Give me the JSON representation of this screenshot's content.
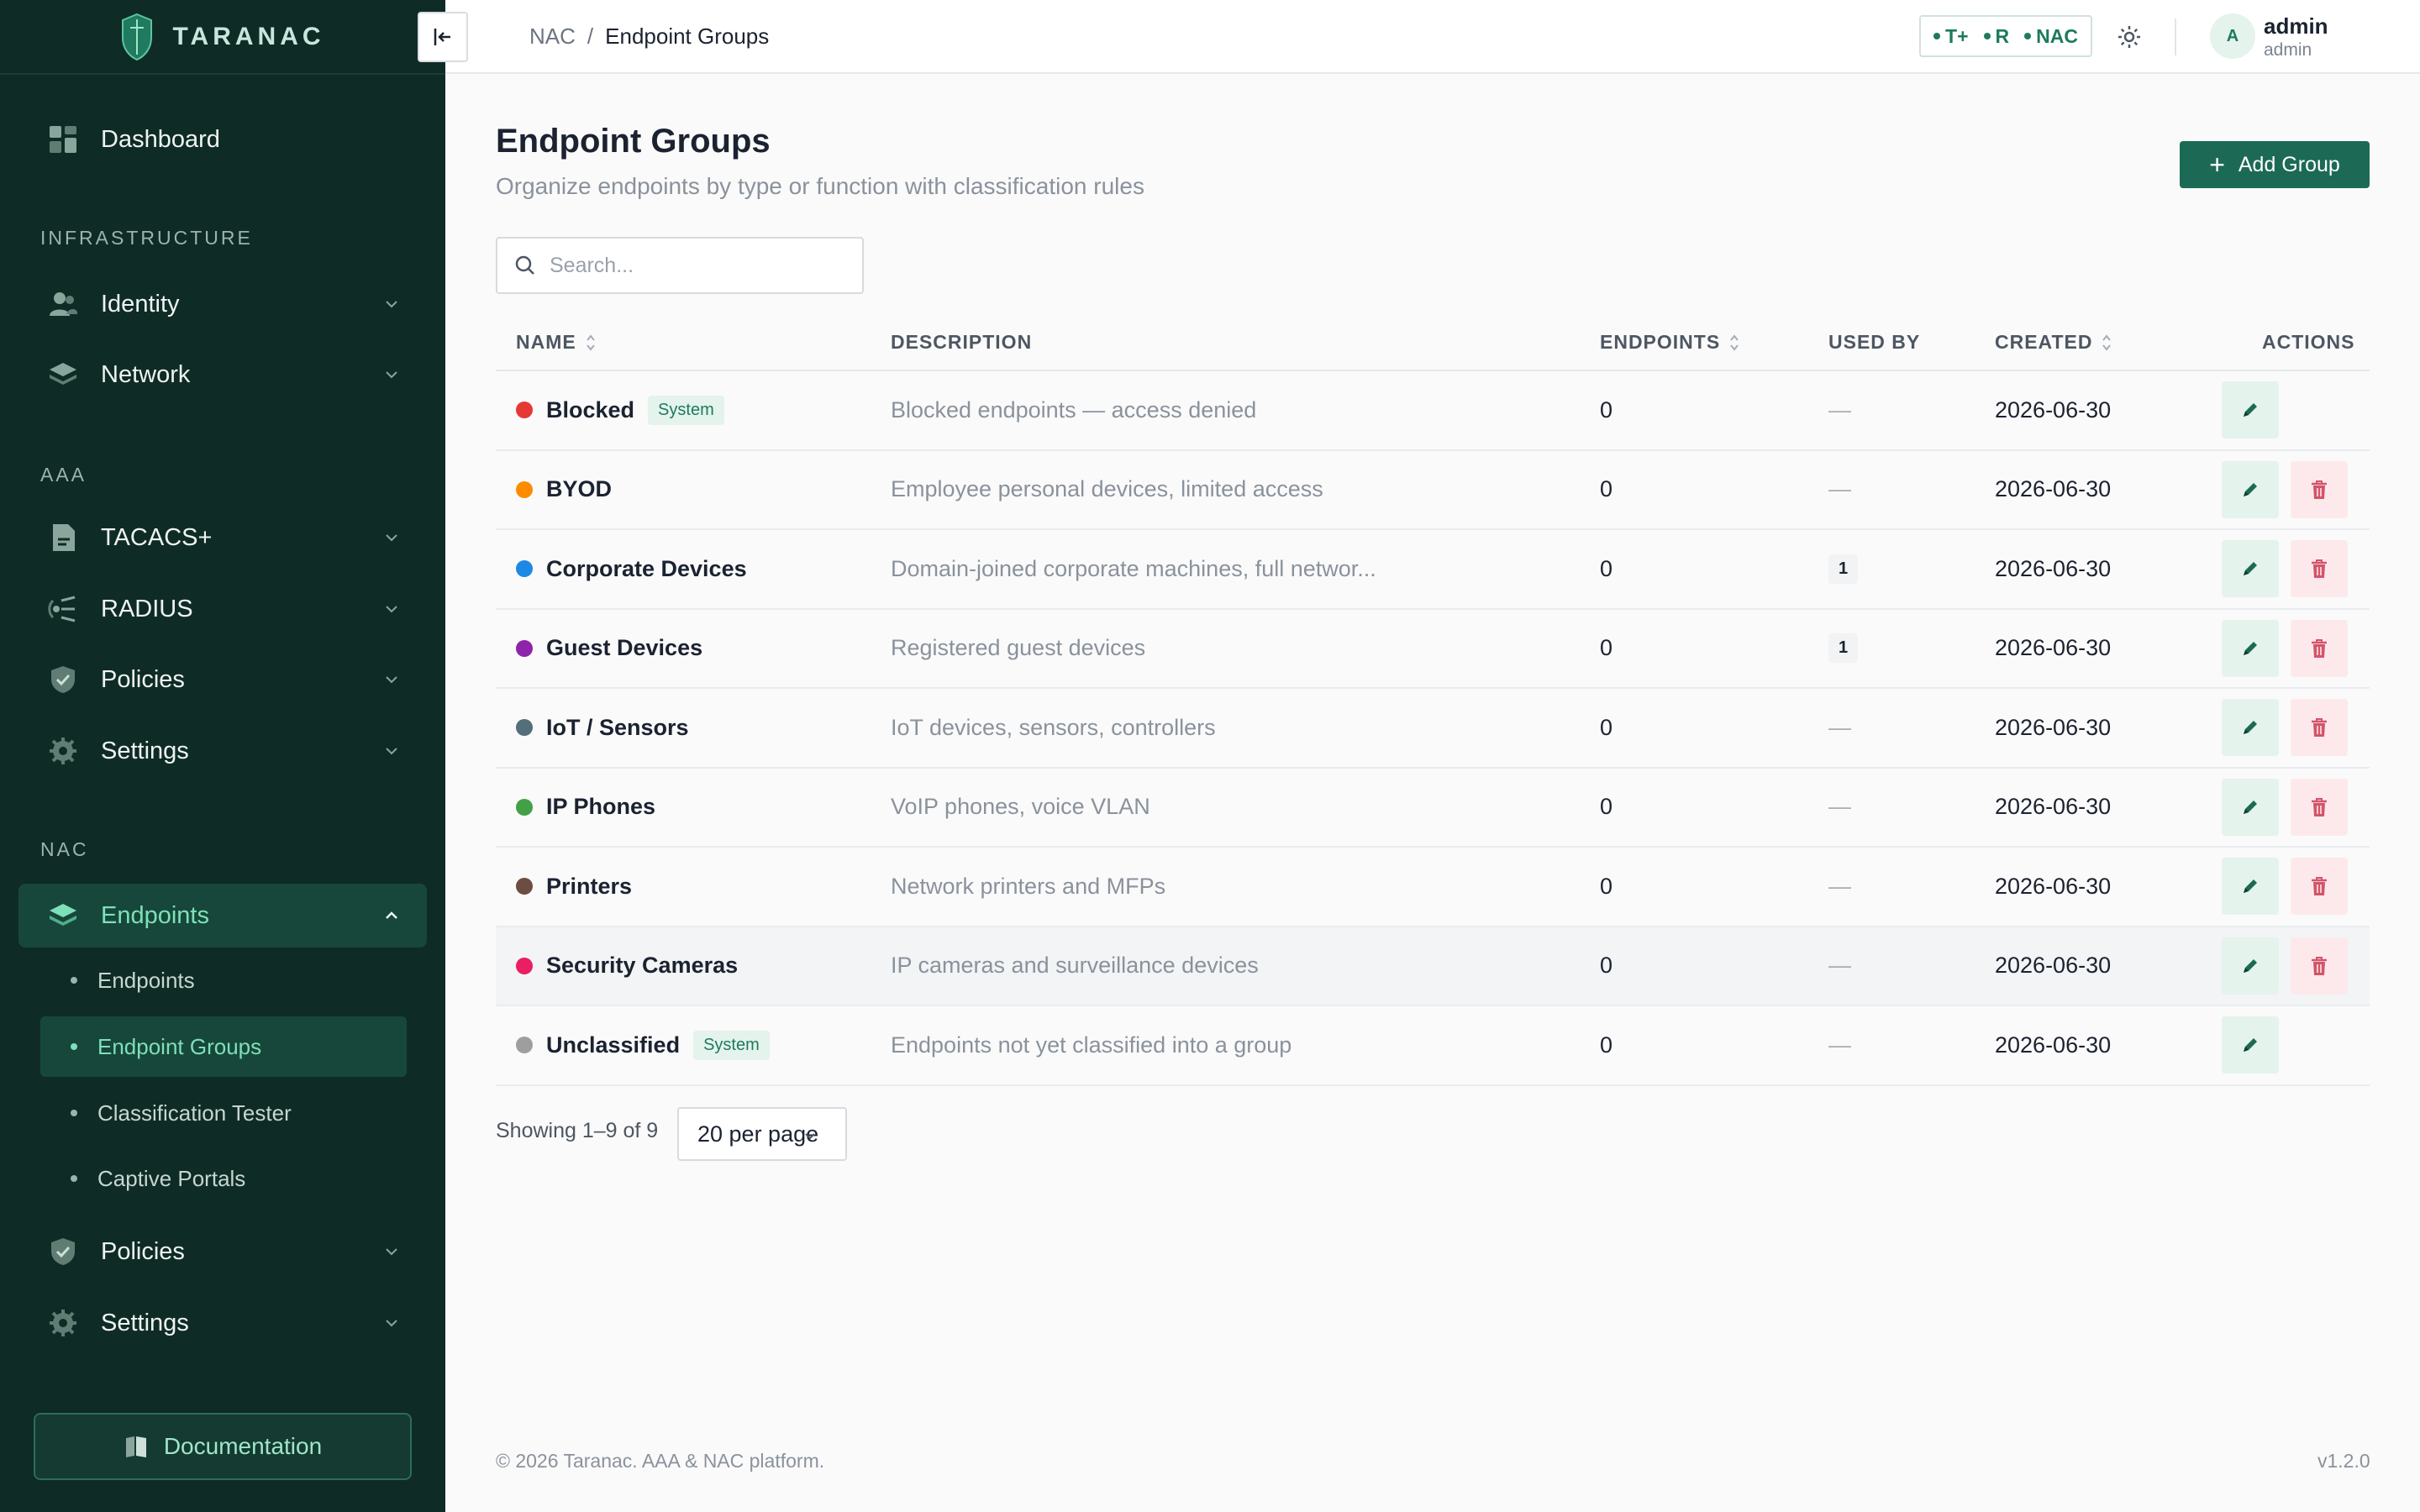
{
  "brand": {
    "name": "TARANAC"
  },
  "sidebar": {
    "top_item": {
      "label": "Dashboard",
      "icon": "dashboard-icon"
    },
    "sections": [
      {
        "label": "INFRASTRUCTURE"
      },
      {
        "label": "AAA"
      },
      {
        "label": "NAC"
      }
    ],
    "items": [
      {
        "label": "Identity",
        "icon": "users-icon"
      },
      {
        "label": "Network",
        "icon": "layers-icon"
      },
      {
        "label": "TACACS+",
        "icon": "file-icon"
      },
      {
        "label": "RADIUS",
        "icon": "radius-icon"
      },
      {
        "label": "Policies",
        "icon": "shield-check-icon"
      },
      {
        "label": "Settings",
        "icon": "gear-icon"
      },
      {
        "label": "Endpoints",
        "icon": "layers-icon"
      },
      {
        "label": "Policies",
        "icon": "shield-check-icon"
      },
      {
        "label": "Settings",
        "icon": "gear-icon"
      }
    ],
    "sub_items": [
      {
        "label": "Endpoints"
      },
      {
        "label": "Endpoint Groups"
      },
      {
        "label": "Classification Tester"
      },
      {
        "label": "Captive Portals"
      }
    ],
    "documentation": "Documentation"
  },
  "topbar": {
    "breadcrumb": {
      "parent": "NAC",
      "separator": "/",
      "current": "Endpoint Groups"
    },
    "modes": [
      "T+",
      "R",
      "NAC"
    ],
    "user": {
      "initial": "A",
      "name": "admin",
      "role": "admin"
    }
  },
  "main": {
    "title": "Endpoint Groups",
    "subtitle": "Organize endpoints by type or function with classification rules",
    "add_button": "Add Group",
    "search_placeholder": "Search...",
    "columns": {
      "name": "NAME",
      "description": "DESCRIPTION",
      "endpoints": "ENDPOINTS",
      "used_by": "USED BY",
      "created": "CREATED",
      "actions": "ACTIONS"
    },
    "rows": [
      {
        "name": "Blocked",
        "badge": "System",
        "color": "#e53935",
        "description": "Blocked endpoints — access denied",
        "endpoints": "0",
        "used_by": "—",
        "created": "2026-06-30"
      },
      {
        "name": "BYOD",
        "badge": "",
        "color": "#fb8c00",
        "description": "Employee personal devices, limited access",
        "endpoints": "0",
        "used_by": "—",
        "created": "2026-06-30"
      },
      {
        "name": "Corporate Devices",
        "badge": "",
        "color": "#1e88e5",
        "description": "Domain-joined corporate machines, full networ...",
        "endpoints": "0",
        "used_by": "1",
        "created": "2026-06-30"
      },
      {
        "name": "Guest Devices",
        "badge": "",
        "color": "#8e24aa",
        "description": "Registered guest devices",
        "endpoints": "0",
        "used_by": "1",
        "created": "2026-06-30"
      },
      {
        "name": "IoT / Sensors",
        "badge": "",
        "color": "#546e7a",
        "description": "IoT devices, sensors, controllers",
        "endpoints": "0",
        "used_by": "—",
        "created": "2026-06-30"
      },
      {
        "name": "IP Phones",
        "badge": "",
        "color": "#43a047",
        "description": "VoIP phones, voice VLAN",
        "endpoints": "0",
        "used_by": "—",
        "created": "2026-06-30"
      },
      {
        "name": "Printers",
        "badge": "",
        "color": "#6d4c41",
        "description": "Network printers and MFPs",
        "endpoints": "0",
        "used_by": "—",
        "created": "2026-06-30"
      },
      {
        "name": "Security Cameras",
        "badge": "",
        "color": "#e91e63",
        "description": "IP cameras and surveillance devices",
        "endpoints": "0",
        "used_by": "—",
        "created": "2026-06-30"
      },
      {
        "name": "Unclassified",
        "badge": "System",
        "color": "#9e9e9e",
        "description": "Endpoints not yet classified into a group",
        "endpoints": "0",
        "used_by": "—",
        "created": "2026-06-30"
      }
    ],
    "pagination": {
      "showing": "Showing 1–9 of 9",
      "per_page": "20 per page"
    }
  },
  "footer": {
    "copyright": "© 2026 Taranac. AAA & NAC platform.",
    "version": "v1.2.0"
  },
  "colors": {
    "sidebar_bg": "#0f2b25",
    "accent": "#1c6a55",
    "active_text": "#7ee0b8"
  }
}
